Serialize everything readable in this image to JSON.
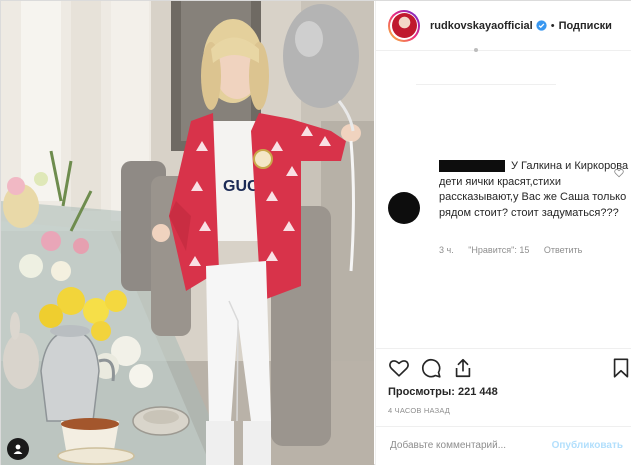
{
  "post": {
    "username": "rudkovskayaofficial",
    "separator": "•",
    "follow_label": "Подписки",
    "icons": {
      "verified": "verified-badge-icon",
      "like": "heart-icon",
      "comment": "comment-bubble-icon",
      "share": "share-icon",
      "save": "bookmark-icon",
      "photo_owner": "person-icon"
    },
    "accent_color": "#3897f0"
  },
  "comment": {
    "text_line1": "У Галкина и",
    "text_rest": "Киркорова дети яички красят,стихи рассказывают,у Вас же Саша только рядом стоит? стоит задуматься???",
    "age": "3 ч.",
    "likes": "\"Нравится\": 15",
    "reply_label": "Ответить"
  },
  "stats": {
    "views": "Просмотры: 221 448",
    "time_ago": "4 ЧАСОВ НАЗАД"
  },
  "composer": {
    "placeholder": "Добавьте комментарий...",
    "publish_label": "Опубликовать"
  }
}
